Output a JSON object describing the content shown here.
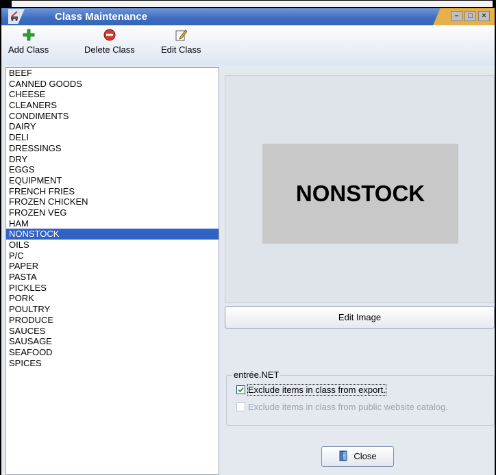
{
  "window": {
    "title": "Class Maintenance"
  },
  "toolbar": {
    "add_label": "Add Class",
    "delete_label": "Delete Class",
    "edit_label": "Edit Class"
  },
  "classes": [
    "BEEF",
    "CANNED GOODS",
    "CHEESE",
    "CLEANERS",
    "CONDIMENTS",
    "DAIRY",
    "DELI",
    "DRESSINGS",
    "DRY",
    "EGGS",
    "EQUIPMENT",
    "FRENCH FRIES",
    "FROZEN CHICKEN",
    "FROZEN VEG",
    "HAM",
    "NONSTOCK",
    "OILS",
    "P/C",
    "PAPER",
    "PASTA",
    "PICKLES",
    "PORK",
    "POULTRY",
    "PRODUCE",
    "SAUCES",
    "SAUSAGE",
    "SEAFOOD",
    "SPICES"
  ],
  "selected_class": "NONSTOCK",
  "image": {
    "text": "NONSTOCK"
  },
  "edit_image_label": "Edit Image",
  "group": {
    "legend": "entrée.NET",
    "exclude_export": {
      "label": "Exclude items in class from export.",
      "checked": true
    },
    "exclude_website": {
      "label": "Exclude items in class from public website catalog.",
      "checked": false,
      "enabled": false
    }
  },
  "close_label": "Close",
  "colors": {
    "selection": "#3163c5",
    "titlebar": "#3c6cc0",
    "add_icon": "#2aa52a",
    "delete_icon": "#d43a2a"
  }
}
